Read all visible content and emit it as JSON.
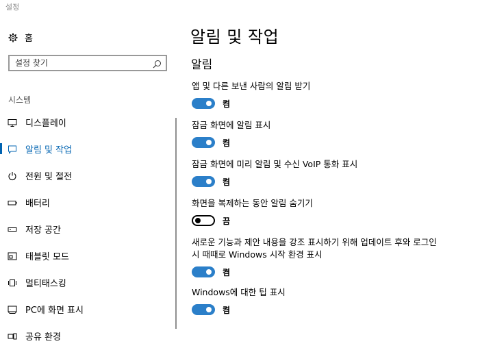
{
  "window": {
    "title": "설정"
  },
  "sidebar": {
    "home_label": "홈",
    "search": {
      "placeholder": "설정 찾기"
    },
    "section_label": "시스템",
    "items": [
      {
        "label": "디스플레이",
        "icon": "monitor-icon"
      },
      {
        "label": "알림 및 작업",
        "icon": "notification-icon",
        "active": true
      },
      {
        "label": "전원 및 절전",
        "icon": "power-icon"
      },
      {
        "label": "배터리",
        "icon": "battery-icon"
      },
      {
        "label": "저장 공간",
        "icon": "storage-icon"
      },
      {
        "label": "태블릿 모드",
        "icon": "tablet-mode-icon"
      },
      {
        "label": "멀티태스킹",
        "icon": "multitasking-icon"
      },
      {
        "label": "PC에 화면 표시",
        "icon": "project-icon"
      },
      {
        "label": "공유 환경",
        "icon": "shared-experiences-icon"
      }
    ]
  },
  "main": {
    "title": "알림 및 작업",
    "section_heading": "알림",
    "settings": [
      {
        "label": "앱 및 다른 보낸 사람의 알림 받기",
        "state": "켬",
        "on": true
      },
      {
        "label": "잠금 화면에 알림 표시",
        "state": "켬",
        "on": true
      },
      {
        "label": "잠금 화면에 미리 알림 및 수신 VoIP 통화 표시",
        "state": "켬",
        "on": true
      },
      {
        "label": "화면을 복제하는 동안 알림 숨기기",
        "state": "끔",
        "on": false
      },
      {
        "label": "새로운 기능과 제안 내용을 강조 표시하기 위해 업데이트 후와 로그인 시 때때로 Windows 시작 환경 표시",
        "state": "켬",
        "on": true
      },
      {
        "label": "Windows에 대한 팁 표시",
        "state": "켬",
        "on": true
      }
    ]
  },
  "colors": {
    "accent": "#0063b1",
    "toggle_on": "#2b7fc9"
  }
}
